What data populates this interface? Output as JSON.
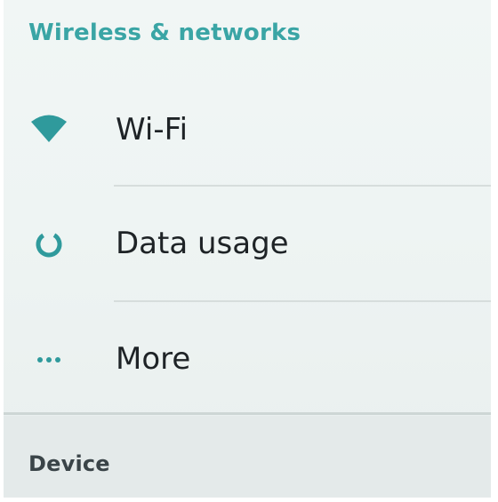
{
  "wireless_section": {
    "header": "Wireless & networks",
    "items": [
      {
        "label": "Wi-Fi",
        "icon": "wifi-icon"
      },
      {
        "label": "Data usage",
        "icon": "data-usage-icon"
      },
      {
        "label": "More",
        "icon": "more-dots-icon"
      }
    ]
  },
  "device_section": {
    "header": "Device"
  },
  "colors": {
    "accent": "#2f9a9c",
    "header_accent": "#3aa5a5",
    "text": "#1e2326",
    "background": "#eef4f3"
  }
}
